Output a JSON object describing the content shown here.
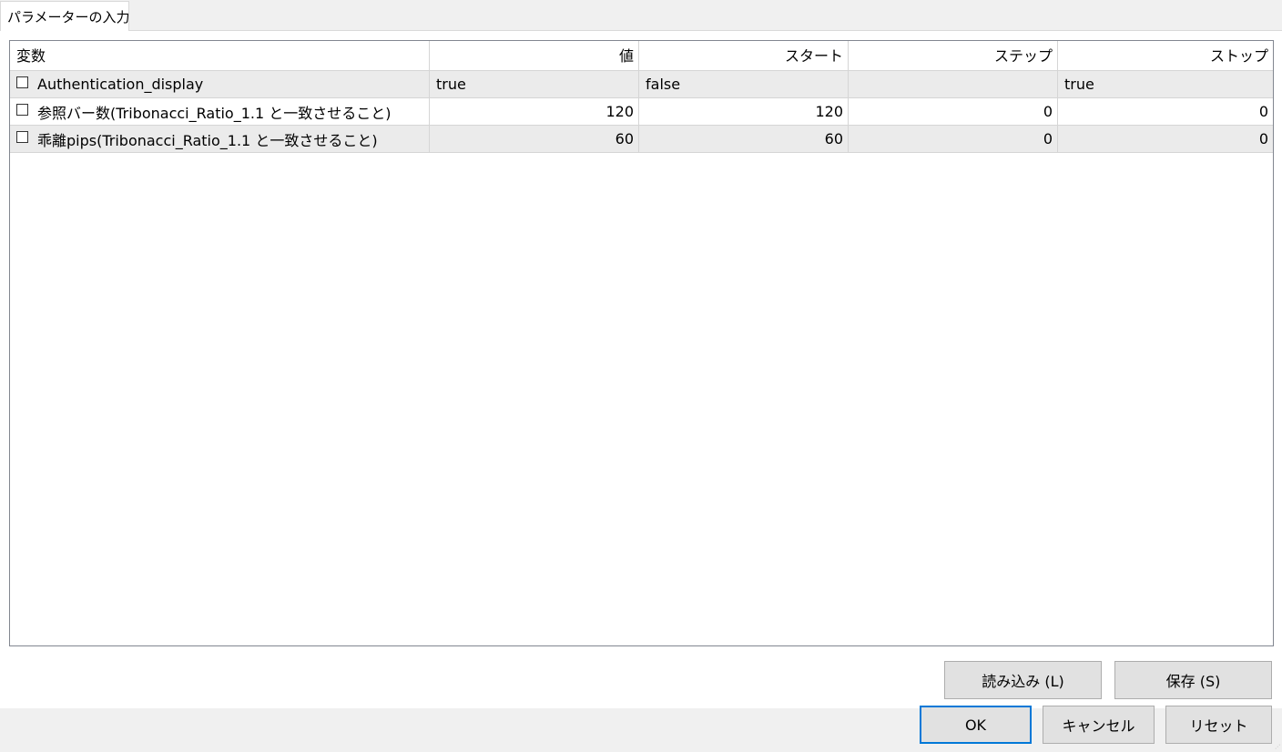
{
  "tab": {
    "label": "パラメーターの入力"
  },
  "table": {
    "columns": [
      "変数",
      "値",
      "スタート",
      "ステップ",
      "ストップ"
    ],
    "rows": [
      {
        "name": "Authentication_display",
        "value": "true",
        "start": "false",
        "step": "",
        "stop": "true",
        "checked": false
      },
      {
        "name": "参照バー数(Tribonacci_Ratio_1.1 と一致させること)",
        "value": "120",
        "start": "120",
        "step": "0",
        "stop": "0",
        "checked": false
      },
      {
        "name": "乖離pips(Tribonacci_Ratio_1.1 と一致させること)",
        "value": "60",
        "start": "60",
        "step": "0",
        "stop": "0",
        "checked": false
      }
    ]
  },
  "buttons": {
    "load": "読み込み (L)",
    "save": "保存 (S)",
    "ok": "OK",
    "cancel": "キャンセル",
    "reset": "リセット"
  }
}
